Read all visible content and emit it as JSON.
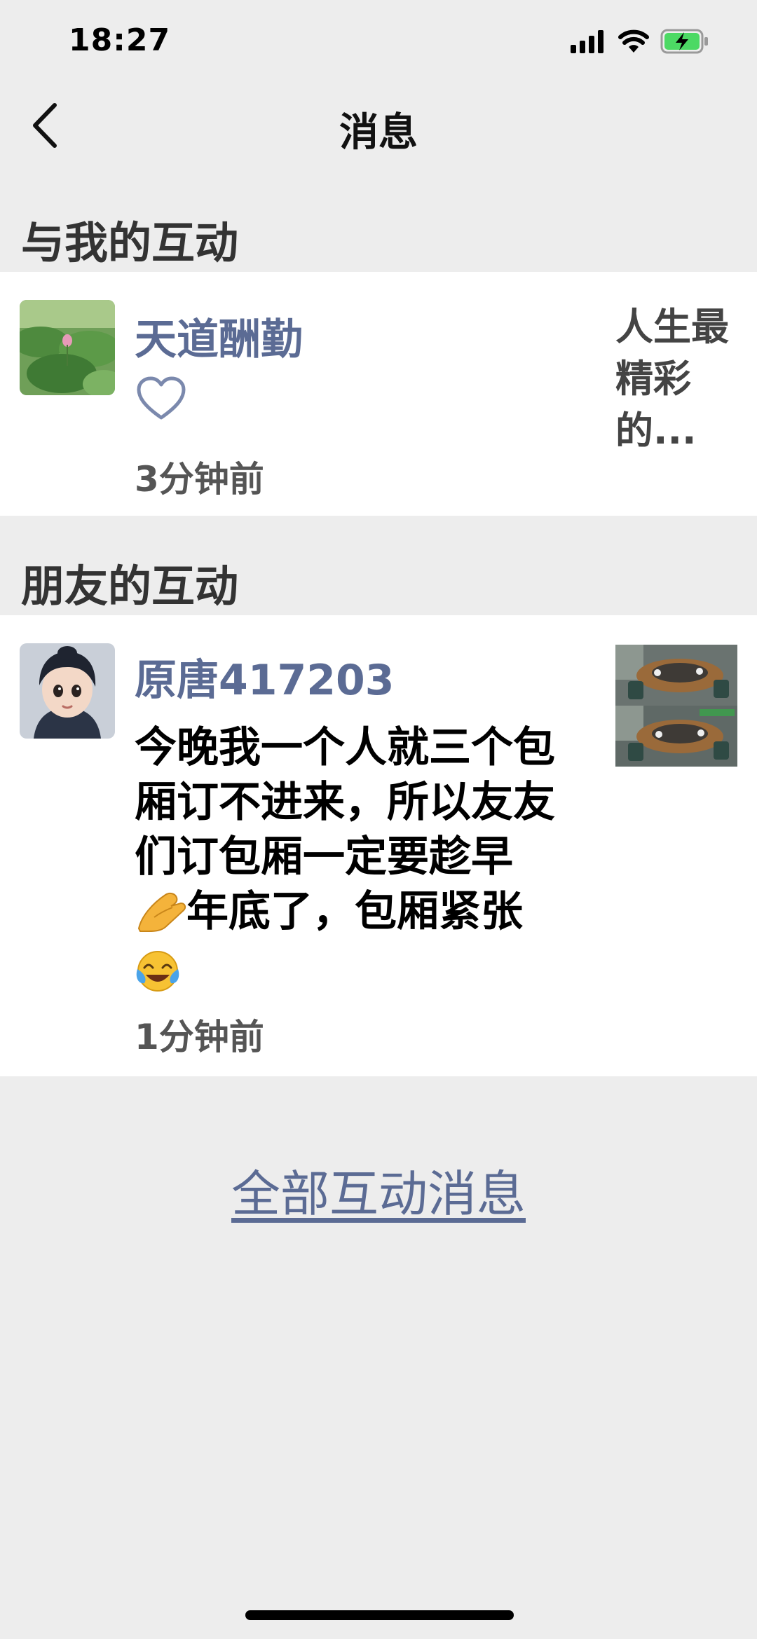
{
  "status_bar": {
    "time": "18:27",
    "signal_icon": "cellular-signal-icon",
    "wifi_icon": "wifi-icon",
    "battery_icon": "battery-charging-icon"
  },
  "nav": {
    "title": "消息",
    "back_icon": "chevron-left-icon"
  },
  "sections": {
    "mine": {
      "header": "与我的互动",
      "item": {
        "nickname": "天道酬勤",
        "action_icon": "heart-outline-icon",
        "time_ago": "3分钟前",
        "post_excerpt": "人生最精彩的..."
      }
    },
    "friends": {
      "header": "朋友的互动",
      "item": {
        "nickname": "原唐417203",
        "comment_parts": {
          "p1": "今晚我一个人就三个包厢订不进来，所以友友们订包厢一定要趁早",
          "p2": "年底了，包厢紧张"
        },
        "emoji1": "pinched-fingers-emoji",
        "emoji2": "tears-of-joy-emoji",
        "time_ago": "1分钟前"
      }
    }
  },
  "footer": {
    "all_messages_link": "全部互动消息"
  },
  "colors": {
    "background": "#ededed",
    "card": "#ffffff",
    "nickname": "#5b6b94",
    "link": "#5b6b94",
    "battery": "#4cd964"
  }
}
